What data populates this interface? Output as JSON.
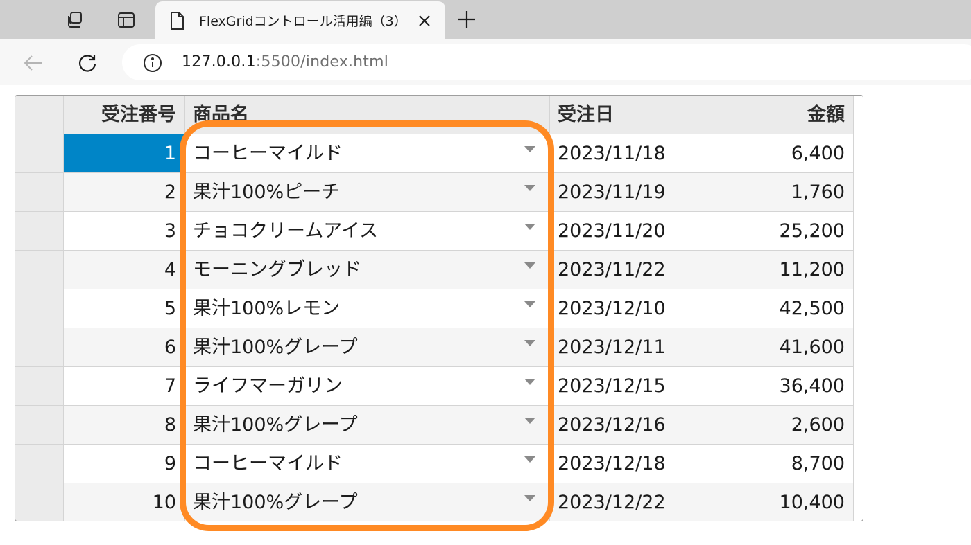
{
  "browser": {
    "tab_title": "FlexGridコントロール活用編（3）",
    "url_host": "127.0.0.1",
    "url_rest": ":5500/index.html",
    "icons": {
      "workspaces": "workspaces-icon",
      "tab_actions": "tab-actions-icon",
      "favicon": "page-icon",
      "close": "close-icon",
      "new_tab": "plus-icon",
      "back": "back-arrow-icon",
      "refresh": "refresh-icon",
      "info": "info-icon"
    }
  },
  "grid": {
    "columns": [
      "受注番号",
      "商品名",
      "受注日",
      "金額"
    ],
    "rows": [
      {
        "id": "1",
        "product": "コーヒーマイルド",
        "date": "2023/11/18",
        "amount": "6,400"
      },
      {
        "id": "2",
        "product": "果汁100%ピーチ",
        "date": "2023/11/19",
        "amount": "1,760"
      },
      {
        "id": "3",
        "product": "チョコクリームアイス",
        "date": "2023/11/20",
        "amount": "25,200"
      },
      {
        "id": "4",
        "product": "モーニングブレッド",
        "date": "2023/11/22",
        "amount": "11,200"
      },
      {
        "id": "5",
        "product": "果汁100%レモン",
        "date": "2023/12/10",
        "amount": "42,500"
      },
      {
        "id": "6",
        "product": "果汁100%グレープ",
        "date": "2023/12/11",
        "amount": "41,600"
      },
      {
        "id": "7",
        "product": "ライフマーガリン",
        "date": "2023/12/15",
        "amount": "36,400"
      },
      {
        "id": "8",
        "product": "果汁100%グレープ",
        "date": "2023/12/16",
        "amount": "2,600"
      },
      {
        "id": "9",
        "product": "コーヒーマイルド",
        "date": "2023/12/18",
        "amount": "8,700"
      },
      {
        "id": "10",
        "product": "果汁100%グレープ",
        "date": "2023/12/22",
        "amount": "10,400"
      }
    ],
    "selected_row": 0,
    "colors": {
      "selection": "#0085c7",
      "highlight_outline": "#ff8a24",
      "header_bg": "#ebebeb",
      "alt_row_bg": "#f5f5f5"
    }
  }
}
